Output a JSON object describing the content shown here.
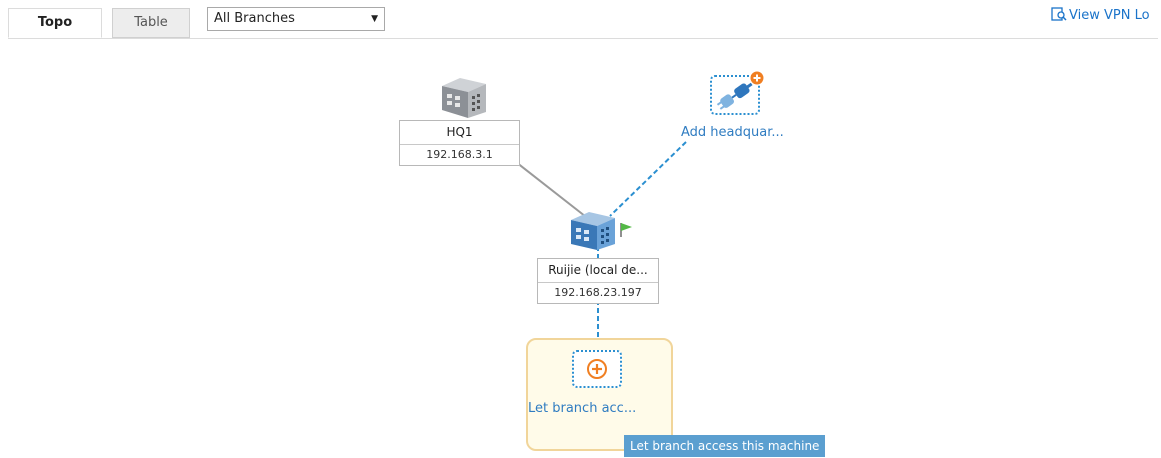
{
  "tabs": {
    "topo_label": "Topo",
    "table_label": "Table"
  },
  "branch_filter": {
    "selected": "All Branches"
  },
  "header_link": {
    "label": "View VPN Lo"
  },
  "topology": {
    "hq_node": {
      "name": "HQ1",
      "ip": "192.168.3.1"
    },
    "local_node": {
      "name": "Ruijie (local de...",
      "ip": "192.168.23.197",
      "flag_color": "#54b847"
    },
    "add_headquarters": {
      "label": "Add headquar..."
    },
    "branch_access": {
      "label": "Let branch acc...",
      "tooltip": "Let branch access this machine"
    }
  },
  "colors": {
    "link_blue": "#2f7cc1",
    "dashed_line": "#2b8fd0",
    "solid_line": "#9a9a9a",
    "add_orange": "#f07f22",
    "card_border": "#f1d59a",
    "card_bg": "#fffbe9",
    "tooltip_bg": "#5b9fd0"
  },
  "icons": {
    "hq_node": "building-icon",
    "local_node": "building-icon",
    "local_flag": "flag-icon",
    "add_headquarters": "plug-connect-icon",
    "add_badge": "plus-badge-icon",
    "branch_access": "plus-circle-icon",
    "view_link": "magnify-document-icon"
  }
}
